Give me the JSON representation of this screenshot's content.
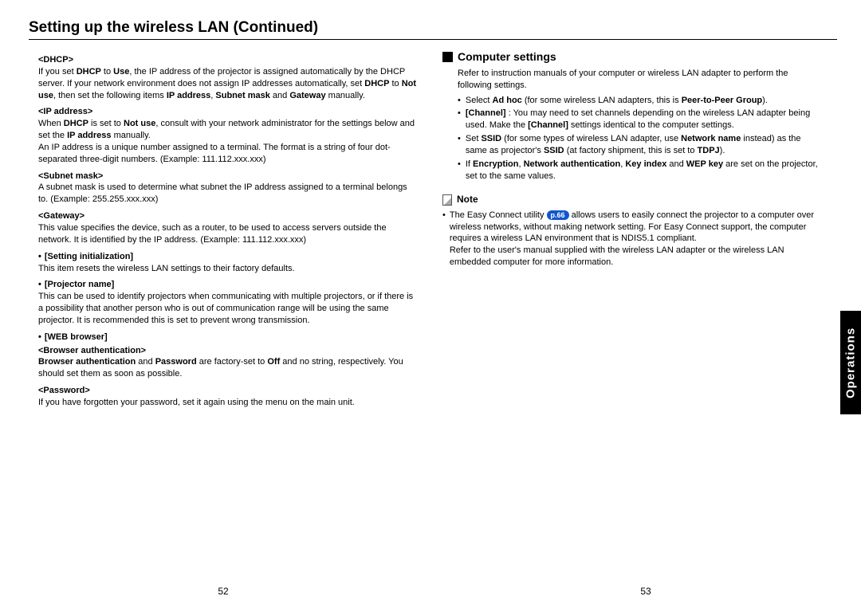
{
  "title": "Setting up the wireless LAN (Continued)",
  "side_tab": "Operations",
  "page_left": "52",
  "page_right": "53",
  "left": {
    "dhcp_label": "<DHCP>",
    "dhcp_body": "If you set <b>DHCP</b> to <b>Use</b>, the IP address of the projector is assigned automatically by the DHCP server. If your network environment does not assign IP addresses automatically, set <b>DHCP</b> to <b>Not use</b>, then set the following items <b>IP address</b>, <b>Subnet mask</b> and <b>Gateway</b> manually.",
    "ip_label": "<IP address>",
    "ip_body1": "When <b>DHCP</b> is set to <b>Not use</b>, consult with your network administrator for the settings below and set the <b>IP address</b> manually.",
    "ip_body2": "An IP address is a unique number assigned to a terminal. The format is a string of four dot-separated three-digit numbers. (Example: 111.112.xxx.xxx)",
    "subnet_label": "<Subnet mask>",
    "subnet_body": "A subnet mask is used to determine what subnet the IP address assigned to a terminal belongs to. (Example: 255.255.xxx.xxx)",
    "gateway_label": "<Gateway>",
    "gateway_body": "This value specifies the device, such as a router, to be used to access servers outside the network. It is identified by the IP address. (Example: 111.112.xxx.xxx)",
    "setinit_label": "[Setting initialization]",
    "setinit_body": "This item resets the wireless LAN settings to their factory defaults.",
    "projname_label": "[Projector name]",
    "projname_body": "This can be used to identify projectors when communicating with multiple projectors, or if there is a possibility that another person who is out of communication range will be using the same projector. It is recommended this is set to prevent wrong transmission.",
    "web_label": "[WEB browser]",
    "browserauth_label": "<Browser authentication>",
    "browserauth_body": "<b>Browser authentication</b> and <b>Password</b> are factory-set to <b>Off</b> and no string, respectively. You should set them as soon as possible.",
    "password_label": "<Password>",
    "password_body": "If you have forgotten your password, set it again using the menu on the main unit."
  },
  "right": {
    "h2": "Computer settings",
    "intro": "Refer to instruction manuals of your computer or wireless LAN adapter to perform the following settings.",
    "b1": "Select <b>Ad hoc</b> (for some wireless  LAN adapters, this is <b>Peer-to-Peer Group</b>).",
    "b2": "<b>[Channel]</b>  : You may need to set channels depending on the wireless LAN adapter being used. Make the <b>[Channel]</b> settings identical to the computer settings.",
    "b3": "Set <b>SSID</b> (for some types of wireless LAN adapter, use <b>Network name</b> instead) as the same as projector's <b>SSID</b> (at factory shipment, this is set to <b>TDPJ</b>).",
    "b4": "If <b>Encryption</b>, <b>Network authentication</b>, <b>Key index</b> and <b>WEP key</b> are set on the projector, set to the same values.",
    "note_label": "Note",
    "note_pre": "The Easy Connect utility ",
    "note_ref": "p.66",
    "note_post": " allows users to easily connect the projector to a computer over wireless networks, without making network setting. For Easy Connect support, the computer requires a wireless LAN environment that is NDIS5.1 compliant.",
    "note_post2": "Refer to the user's manual supplied with the wireless LAN adapter or the wireless LAN embedded computer for more information."
  }
}
